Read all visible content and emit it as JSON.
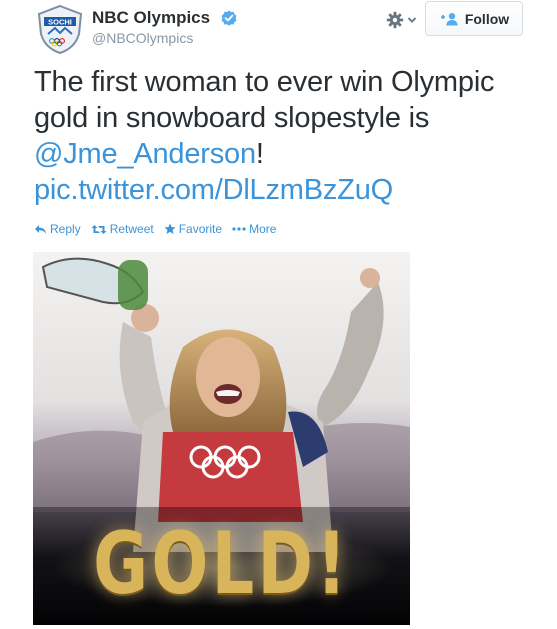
{
  "author": {
    "name": "NBC Olympics",
    "handle": "@NBCOlympics",
    "avatar_text": "SOCHI",
    "verified": true
  },
  "header": {
    "follow_label": "Follow",
    "settings_icon": "gear-icon"
  },
  "tweet": {
    "text_plain": "The first woman to ever win Olympic gold in snowboard slopestyle is ",
    "mention": "@Jme_Anderson",
    "after_mention": "!",
    "link": "pic.twitter.com/DlLzmBzZuQ"
  },
  "actions": {
    "reply": "Reply",
    "retweet": "Retweet",
    "favorite": "Favorite",
    "more": "More"
  },
  "photo": {
    "overlay_text": "GOLD!"
  },
  "colors": {
    "link": "#3b94d9",
    "text": "#292f33",
    "muted": "#8899a6",
    "verified": "#55acee"
  }
}
